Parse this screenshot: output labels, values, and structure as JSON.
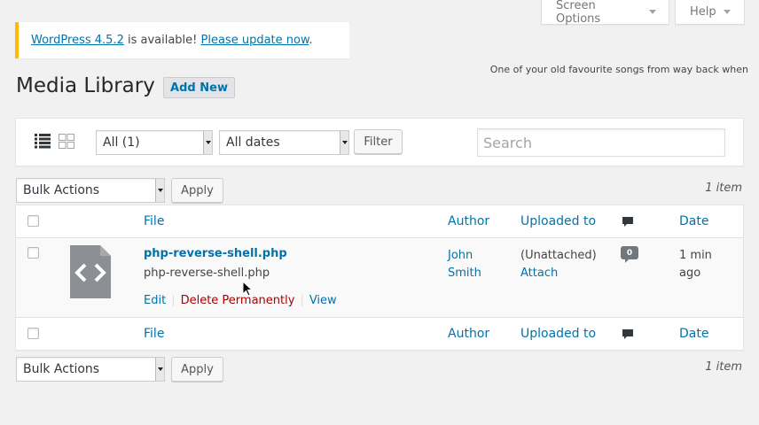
{
  "screen_meta": {
    "screen_options": "Screen Options",
    "help": "Help"
  },
  "notice": {
    "link1": "WordPress 4.5.2",
    "middle": " is available! ",
    "link2": "Please update now",
    "end": "."
  },
  "hello_dolly": "One of your old favourite songs from way back when",
  "page": {
    "title": "Media Library",
    "add_new": "Add New"
  },
  "filter_bar": {
    "view_list_icon": "list-view-icon",
    "view_grid_icon": "grid-view-icon",
    "type_select": "All (1)",
    "date_select": "All dates",
    "filter_button": "Filter",
    "search_placeholder": "Search"
  },
  "bulk_top": {
    "select": "Bulk Actions",
    "apply": "Apply",
    "count": "1 item"
  },
  "table": {
    "columns": {
      "file": "File",
      "author": "Author",
      "uploaded_to": "Uploaded to",
      "comments_icon": "comment-icon",
      "date": "Date"
    },
    "rows": [
      {
        "icon": "code-file-icon",
        "title": "php-reverse-shell.php",
        "filename": "php-reverse-shell.php",
        "actions": {
          "edit": "Edit",
          "delete": "Delete Permanently",
          "view": "View"
        },
        "author": "John Smith",
        "uploaded_status": "(Unattached)",
        "attach": "Attach",
        "comments": "0",
        "date": "1 min ago"
      }
    ]
  },
  "bulk_bottom": {
    "select": "Bulk Actions",
    "apply": "Apply",
    "count": "1 item"
  },
  "colors": {
    "link": "#0073aa",
    "notice_border": "#ffb900",
    "delete": "#aa0000",
    "background": "#f1f1f1"
  }
}
